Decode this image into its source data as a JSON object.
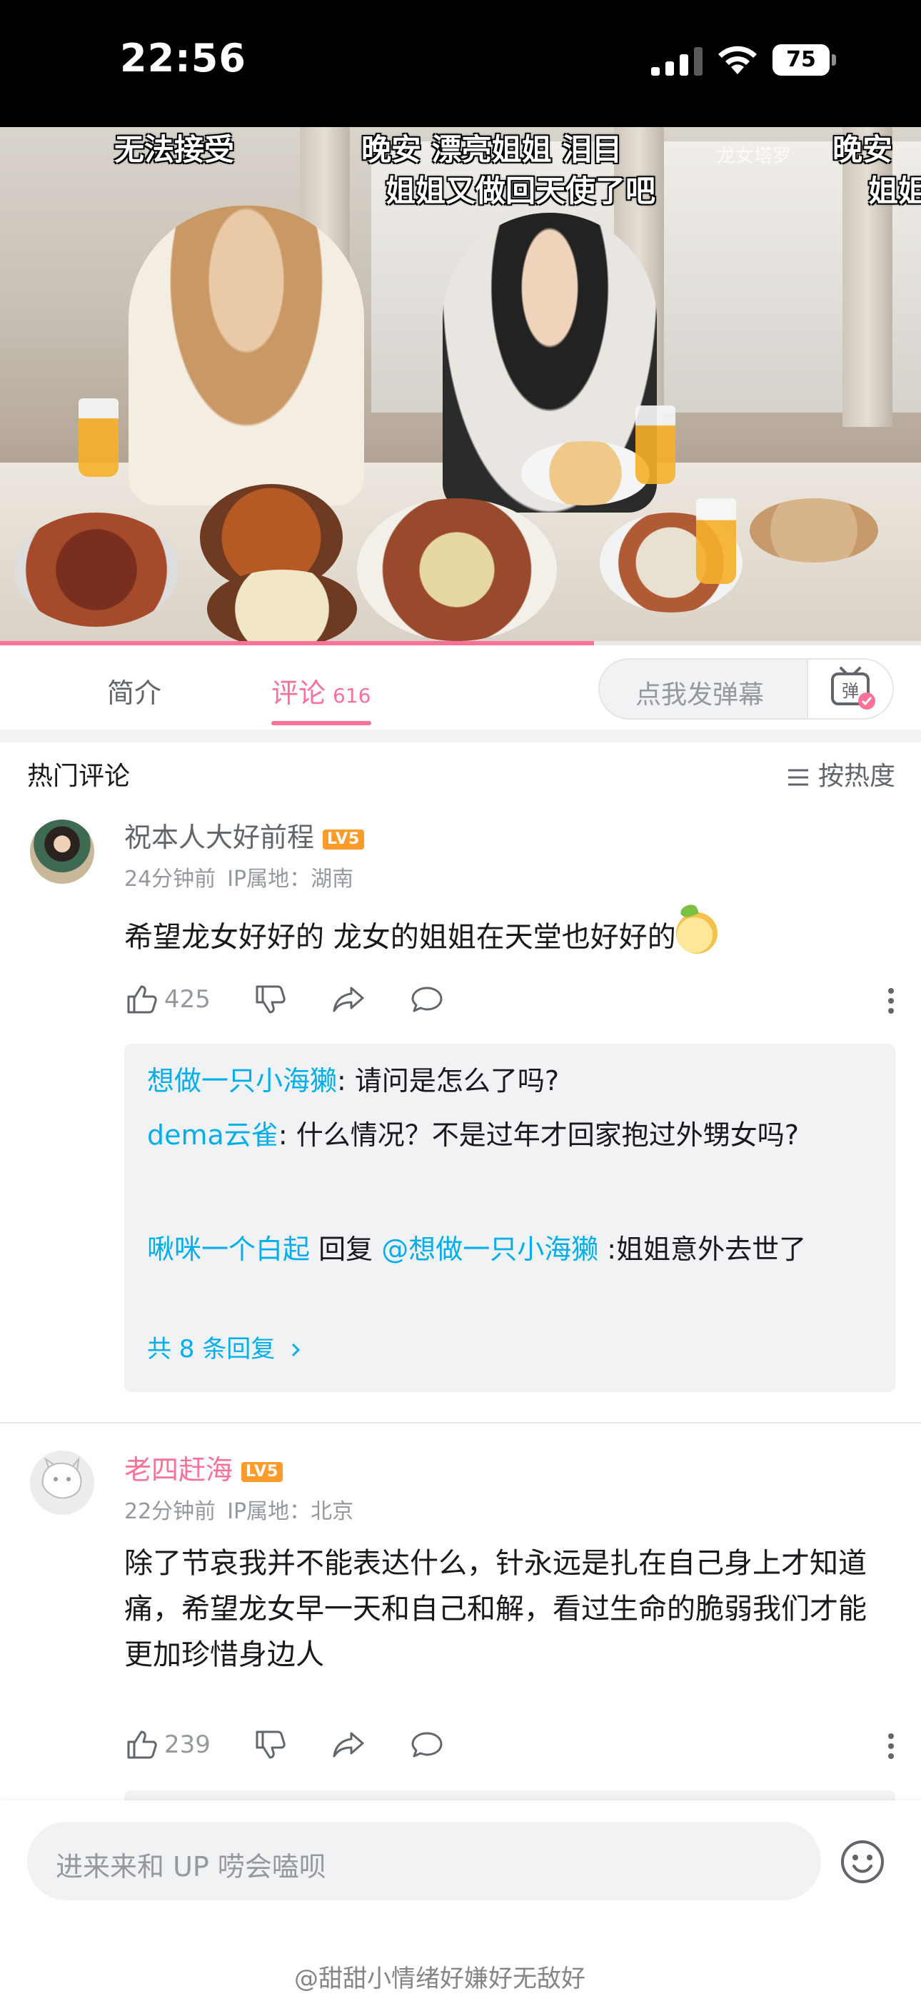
{
  "status_bar": {
    "time": "22:56",
    "battery": "75"
  },
  "video": {
    "danmaku": [
      "无法接受",
      "晚安 漂亮姐姐 泪目",
      "姐姐又做回天使了吧",
      "晚安",
      "姐姐"
    ],
    "watermark": "龙女塔罗",
    "progress": 0.645
  },
  "tabs": {
    "intro": "简介",
    "comments": "评论",
    "comment_count": "616",
    "danmaku_placeholder": "点我发弹幕",
    "danmaku_button_icon": "danmaku-tv-icon"
  },
  "comments_header": {
    "title": "热门评论",
    "sort": "按热度"
  },
  "comments": [
    {
      "user": "祝本人大好前程",
      "level": "LV5",
      "time": "24分钟前",
      "ip": "IP属地：湖南",
      "text": "希望龙女好好的 龙女的姐姐在天堂也好好的",
      "likes": "425",
      "replies": [
        {
          "user": "想做一只小海獭",
          "text": ": 请问是怎么了吗?"
        },
        {
          "user": "dema云雀",
          "text": ": 什么情况？不是过年才回家抱过外甥女吗?"
        },
        {
          "user": "啾咪一个白起",
          "mid": " 回复 ",
          "mention": "@想做一只小海獭",
          "text": " :姐姐意外去世了"
        }
      ],
      "reply_more": "共 8 条回复"
    },
    {
      "user": "老四赶海",
      "level": "LV5",
      "time": "22分钟前",
      "ip": "IP属地：北京",
      "text": "除了节哀我并不能表达什么，针永远是扎在自己身上才知道痛，希望龙女早一天和自己和解，看过生命的脆弱我们才能更加珍惜身边人",
      "likes": "239"
    }
  ],
  "bottom": {
    "input_placeholder": "进来来和 UP 唠会嗑呗",
    "watermark": "@甜甜小情绪好嫌好无敌好"
  },
  "colors": {
    "accent": "#fb7299",
    "link": "#00aeec",
    "level": "#ff9b2b"
  }
}
